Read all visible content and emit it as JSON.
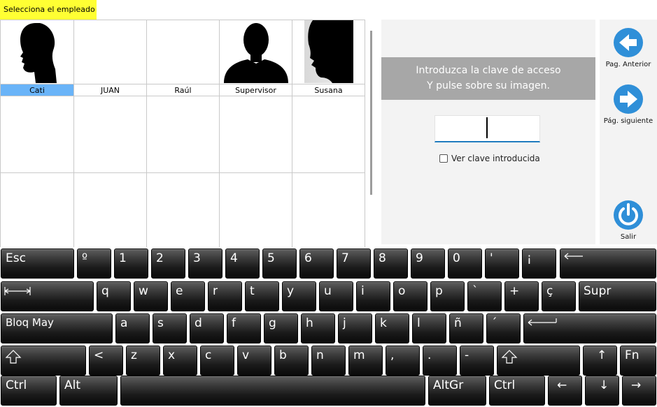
{
  "header": {
    "title": "Selecciona el empleado"
  },
  "employees": [
    {
      "name": "Cati",
      "selected": true
    },
    {
      "name": "JUAN",
      "selected": false
    },
    {
      "name": "Raúl",
      "selected": false
    },
    {
      "name": "Supervisor",
      "selected": false
    },
    {
      "name": "Susana",
      "selected": false
    }
  ],
  "login": {
    "line1": "Introduzca la clave de acceso",
    "line2": "Y pulse sobre su imagen.",
    "password_value": "",
    "show_password_label": "Ver clave introducida"
  },
  "nav": {
    "prev_label": "Pag. Anterior",
    "next_label": "Pág. siguiente",
    "exit_label": "Salir"
  },
  "keyboard": {
    "row1": [
      "Esc",
      "º",
      "1",
      "2",
      "3",
      "4",
      "5",
      "6",
      "7",
      "8",
      "9",
      "0",
      "'",
      "¡"
    ],
    "row2": [
      "q",
      "w",
      "e",
      "r",
      "t",
      "y",
      "u",
      "i",
      "o",
      "p",
      "`",
      "+",
      "ç",
      "Supr"
    ],
    "row3": [
      "Bloq May",
      "a",
      "s",
      "d",
      "f",
      "g",
      "h",
      "j",
      "k",
      "l",
      "ñ",
      "´"
    ],
    "row4": [
      "<",
      "z",
      "x",
      "c",
      "v",
      "b",
      "n",
      "m",
      ",",
      ".",
      "-",
      "↑",
      "Fn"
    ],
    "row5": [
      "Ctrl",
      "Alt",
      "AltGr",
      "Ctrl",
      "←",
      "↓",
      "→"
    ]
  },
  "colors": {
    "accent": "#2f8fd8",
    "selected_row": "#6ab4f8",
    "title_bg": "#ffff33",
    "message_bg": "#a7a7a7"
  }
}
